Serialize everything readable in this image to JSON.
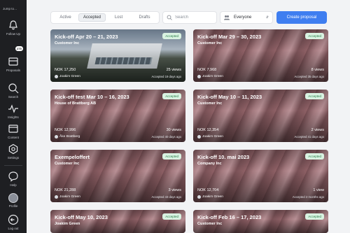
{
  "sidebar": {
    "brand": "Jump to…",
    "badge": "275",
    "items": {
      "follow_up": "Follow Up",
      "proposals": "Proposals",
      "search": "Search",
      "insights": "Insights",
      "content": "Content",
      "settings": "Settings",
      "help": "Help",
      "profile": "Profile",
      "logout": "Log out"
    }
  },
  "toolbar": {
    "tabs": [
      "Active",
      "Accepted",
      "Lost",
      "Drafts"
    ],
    "search_placeholder": "Search",
    "filter_value": "Everyone",
    "create_label": "Create proposal"
  },
  "cards": [
    {
      "title": "Kick-off Apr 20 – 21, 2023",
      "company": "Customer Inc",
      "status": "Accepted",
      "price": "NOK 17,250",
      "owner": "Joakim Green",
      "views": "25 views",
      "ago": "Accepted 19 days ago"
    },
    {
      "title": "Kick-off Mar 29 – 30, 2023",
      "company": "Customer Inc",
      "status": "Accepted",
      "price": "NOK 7,968",
      "owner": "Joakim Green",
      "views": "8 views",
      "ago": "Accepted 35 days ago"
    },
    {
      "title": "Kick-off test Mar 10 – 16, 2023",
      "company": "House of Brattberg AB",
      "status": "Accepted",
      "price": "NOK 12,996",
      "owner": "Åke Brattberg",
      "views": "30 views",
      "ago": "Accepted 40 days ago"
    },
    {
      "title": "Kick-off May 10 – 11, 2023",
      "company": "Customer Inc",
      "status": "Accepted",
      "price": "NOK 12,354",
      "owner": "Joakim Green",
      "views": "2 views",
      "ago": "Accepted 41 days ago"
    },
    {
      "title": "Exempeloffert",
      "company": "Customer Inc",
      "status": "Accepted",
      "price": "NOK 21,288",
      "owner": "Joakim Green",
      "views": "3 views",
      "ago": "Accepted 43 days ago"
    },
    {
      "title": "Kick-off 10. mai 2023",
      "company": "Company Inc",
      "status": "Accepted",
      "price": "NOK 12,704",
      "owner": "Joakim Green",
      "views": "1 view",
      "ago": "Accepted 2 months ago"
    },
    {
      "title": "Kick-off May 10, 2023",
      "company": "Joakim Green",
      "status": "Accepted",
      "price": "",
      "owner": "",
      "views": "",
      "ago": ""
    },
    {
      "title": "Kick-off Feb 16 – 17, 2023",
      "company": "Customer Inc",
      "status": "Accepted",
      "price": "",
      "owner": "",
      "views": "",
      "ago": ""
    }
  ]
}
